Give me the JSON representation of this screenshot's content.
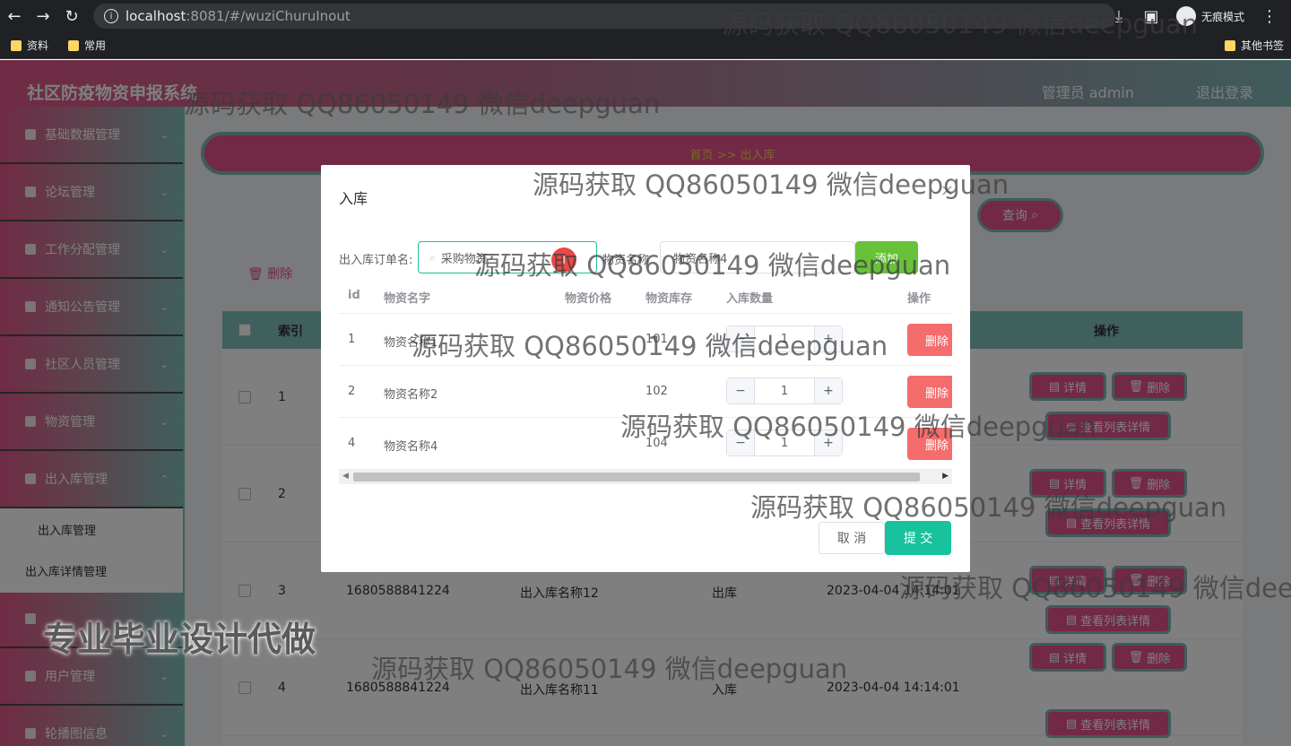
{
  "browser": {
    "url_host": "localhost",
    "url_path": ":8081/#/wuziChuruInout",
    "incognito_label": "无痕模式",
    "bookmarks": [
      "资料",
      "常用"
    ],
    "other_bookmarks": "其他书签"
  },
  "header": {
    "title": "社区防疫物资申报系统",
    "admin": "管理员 admin",
    "logout": "退出登录"
  },
  "sidebar": {
    "items": [
      {
        "label": "基础数据管理"
      },
      {
        "label": "论坛管理"
      },
      {
        "label": "工作分配管理"
      },
      {
        "label": "通知公告管理"
      },
      {
        "label": "社区人员管理"
      },
      {
        "label": "物资管理"
      },
      {
        "label": "出入库管理"
      }
    ],
    "sub_items": [
      "出入库管理",
      "出入库详情管理"
    ],
    "bottom_items": [
      {
        "label": "用户管理"
      },
      {
        "label": "轮播图信息"
      }
    ]
  },
  "main": {
    "breadcrumb": "首页 >> 出入库",
    "query_btn": "查询",
    "delete_btn": "删除",
    "table": {
      "headers": {
        "index": "索引",
        "op": "操作"
      },
      "rows": [
        {
          "index": "1",
          "order": "",
          "name": "",
          "type": "",
          "time": ""
        },
        {
          "index": "2",
          "order": "",
          "name": "",
          "type": "",
          "time": ""
        },
        {
          "index": "3",
          "order": "1680588841224",
          "name": "出入库名称12",
          "type": "出库",
          "time": "2023-04-04 14:14:01"
        },
        {
          "index": "4",
          "order": "1680588841224",
          "name": "出入库名称11",
          "type": "入库",
          "time": "2023-04-04 14:14:01"
        }
      ],
      "ops": {
        "detail": "详情",
        "delete": "删除",
        "list_detail": "查看列表详情"
      }
    }
  },
  "dialog": {
    "title": "入库",
    "order_label": "出入库订单名:",
    "order_value": "采购物资",
    "goods_label": "物资名称",
    "goods_select": "物资名称4",
    "add_btn": "添加",
    "columns": {
      "id": "id",
      "name": "物资名字",
      "price": "物资价格",
      "stock": "物资库存",
      "qty": "入库数量",
      "op": "操作"
    },
    "rows": [
      {
        "id": "1",
        "name": "物资名称1",
        "price": "",
        "stock": "101",
        "qty": "1",
        "op": "删除"
      },
      {
        "id": "2",
        "name": "物资名称2",
        "price": "",
        "stock": "102",
        "qty": "1",
        "op": "删除"
      },
      {
        "id": "4",
        "name": "物资名称4",
        "price": "",
        "stock": "104",
        "qty": "1",
        "op": "删除"
      }
    ],
    "cancel": "取 消",
    "submit": "提 交"
  },
  "watermarks": {
    "text": "源码获取 QQ86050149 微信deepguan",
    "promo": "专业毕业设计代做"
  }
}
